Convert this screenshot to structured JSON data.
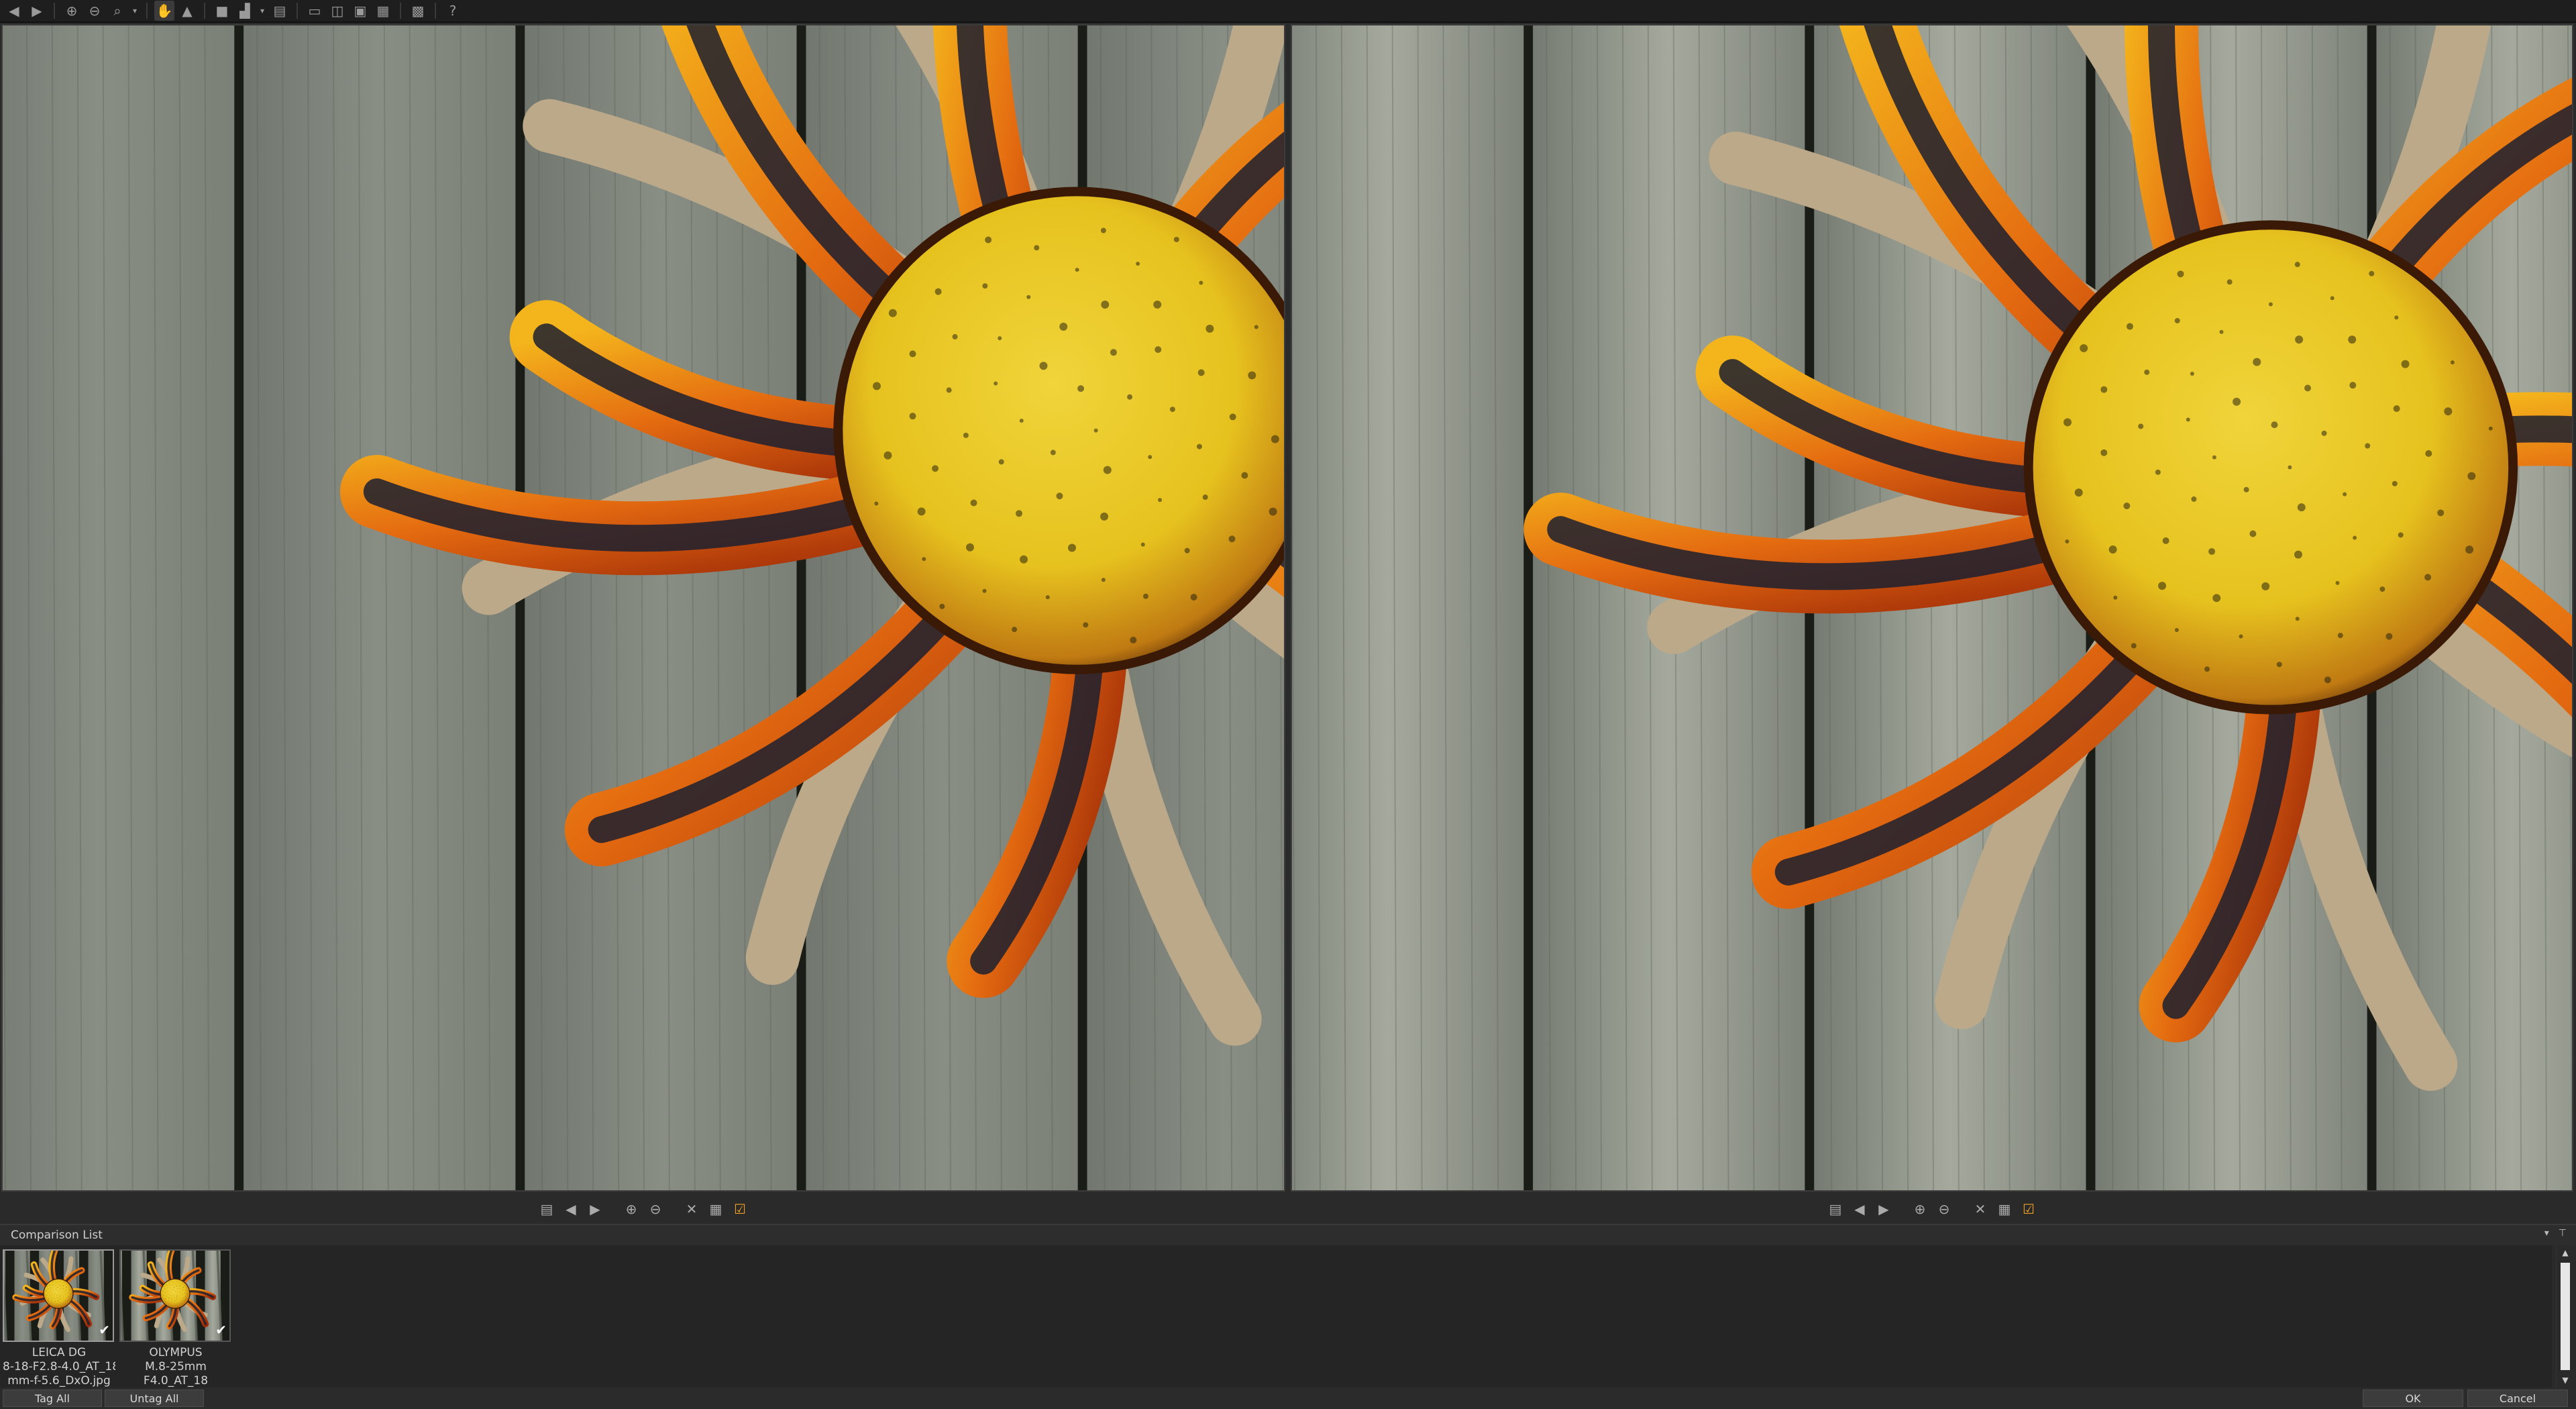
{
  "toolbar": {
    "buttons": [
      {
        "name": "back-icon",
        "glyph": "◀"
      },
      {
        "name": "forward-icon",
        "glyph": "▶"
      },
      {
        "name": "zoom-in-icon",
        "glyph": "⊕"
      },
      {
        "name": "zoom-out-icon",
        "glyph": "⊖"
      },
      {
        "name": "zoom-menu-icon",
        "glyph": "⌕"
      },
      {
        "name": "hand-tool-icon",
        "glyph": "✋"
      },
      {
        "name": "warning-icon",
        "glyph": "▲"
      },
      {
        "name": "single-view-icon",
        "glyph": "■"
      },
      {
        "name": "histogram-icon",
        "glyph": "▟"
      },
      {
        "name": "stack-icon",
        "glyph": "▤"
      },
      {
        "name": "layout-1-icon",
        "glyph": "▭"
      },
      {
        "name": "layout-2-icon",
        "glyph": "◫"
      },
      {
        "name": "layout-3-icon",
        "glyph": "▣"
      },
      {
        "name": "layout-4-icon",
        "glyph": "▦"
      },
      {
        "name": "grid-icon",
        "glyph": "▩"
      },
      {
        "name": "help-icon",
        "glyph": "?"
      }
    ]
  },
  "pane_toolbar": {
    "buttons": [
      {
        "name": "save-icon",
        "glyph": "▤"
      },
      {
        "name": "prev-image-icon",
        "glyph": "◀"
      },
      {
        "name": "next-image-icon",
        "glyph": "▶"
      },
      {
        "name": "zoom-in-icon",
        "glyph": "⊕"
      },
      {
        "name": "zoom-out-icon",
        "glyph": "⊖"
      },
      {
        "name": "remove-icon",
        "glyph": "✕"
      },
      {
        "name": "grid-view-icon",
        "glyph": "▦"
      },
      {
        "name": "tag-icon",
        "glyph": "☑"
      }
    ]
  },
  "comparison_list": {
    "title": "Comparison List",
    "thumbnails": [
      {
        "line1": "LEICA DG",
        "line2": "8-18-F2.8-4.0_AT_18",
        "line3": "mm-f-5.6_DxO.jpg",
        "selected": true
      },
      {
        "line1": "OLYMPUS",
        "line2": "M.8-25mm",
        "line3": "F4.0_AT_18",
        "selected": false
      }
    ],
    "header_controls": [
      "▾",
      "⊤"
    ]
  },
  "bottom": {
    "tag_all": "Tag All",
    "untag_all": "Untag All",
    "ok": "OK",
    "cancel": "Cancel"
  },
  "colors": {
    "background": "#2a2a2a",
    "wood": "#8a8f86",
    "sun_yellow": "#e6c21e",
    "sun_orange": "#e46a10",
    "ray_dark": "#1c2030",
    "sand": "#bba98a",
    "tag_orange": "#f0a020"
  }
}
